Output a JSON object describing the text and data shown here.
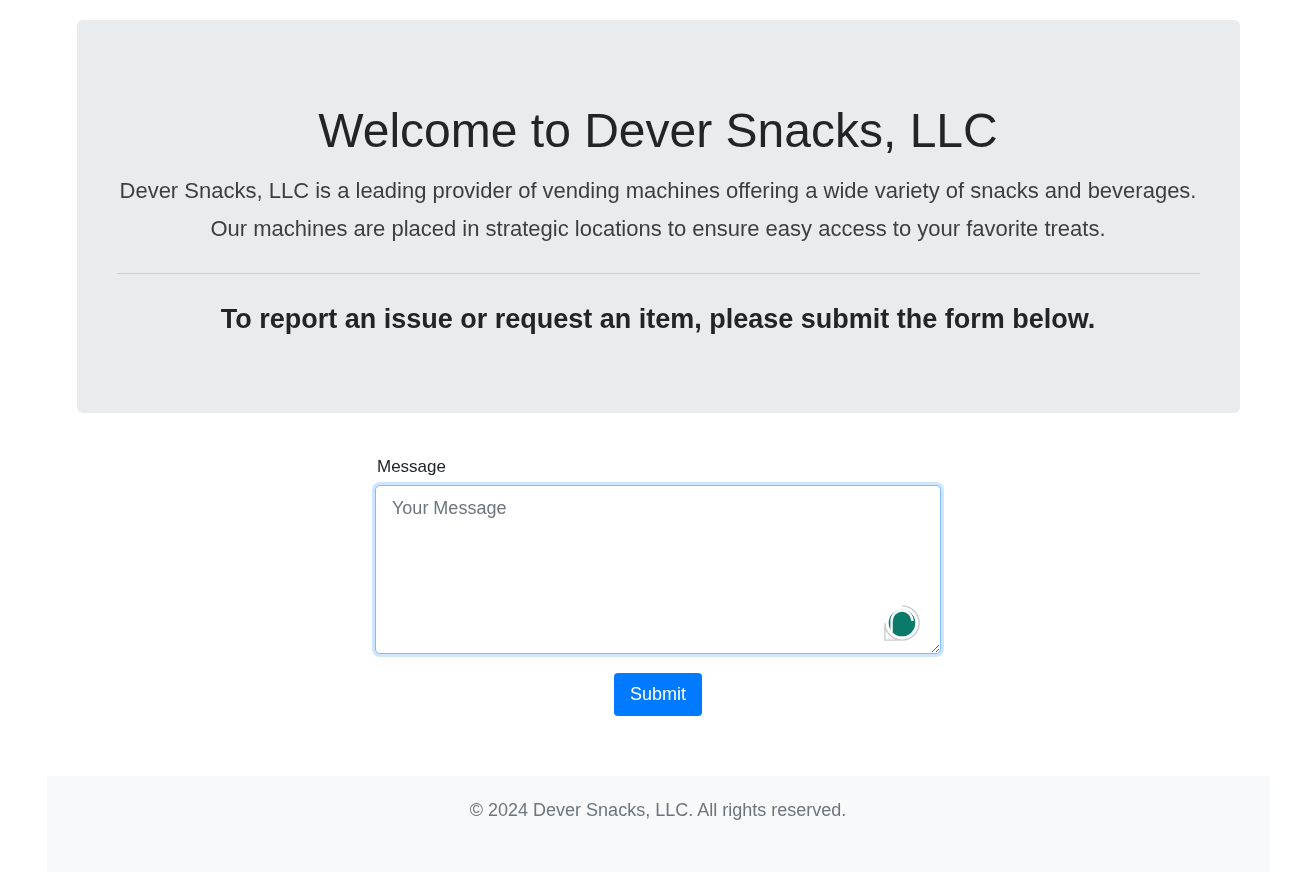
{
  "hero": {
    "title": "Welcome to Dever Snacks, LLC",
    "lead": "Dever Snacks, LLC is a leading provider of vending machines offering a wide variety of snacks and beverages. Our machines are placed in strategic locations to ensure easy access to your favorite treats.",
    "subheading": "To report an issue or request an item, please submit the form below."
  },
  "form": {
    "label": "Message",
    "placeholder": "Your Message",
    "focused": true,
    "submit": "Submit"
  },
  "footer": {
    "text": "© 2024 Dever Snacks, LLC. All rights reserved."
  }
}
